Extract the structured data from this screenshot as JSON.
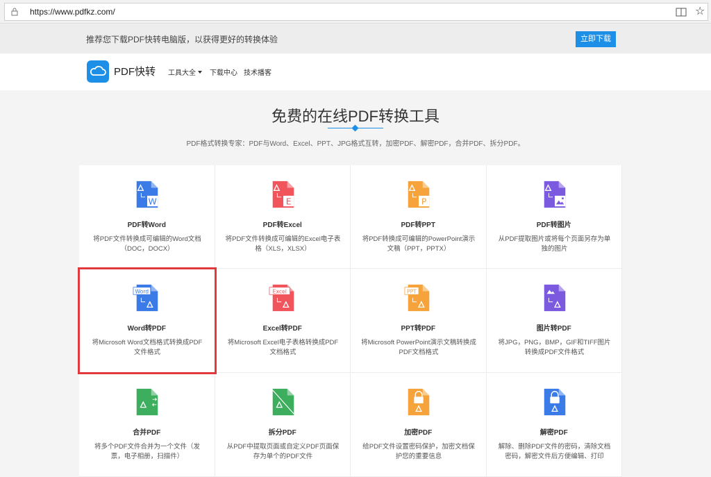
{
  "browser": {
    "url": "https://www.pdfkz.com/",
    "lock_icon": "lock-icon",
    "reader_icon": "reader-view-icon",
    "star_icon": "favorite-star-icon"
  },
  "promo": {
    "text": "推荐您下载PDF快转电脑版，以获得更好的转换体验",
    "button": "立即下载"
  },
  "nav": {
    "logo_text": "PDF快转",
    "items": [
      "工具大全",
      "下载中心",
      "技术播客"
    ]
  },
  "hero": {
    "title": "免费的在线PDF转换工具",
    "subtitle": "PDF格式转换专家：PDF与Word、Excel、PPT、JPG格式互转，加密PDF、解密PDF，合并PDF、拆分PDF。"
  },
  "colors": {
    "accent": "#1d8fe7",
    "word": "#3b7be8",
    "excel": "#f2545b",
    "ppt": "#f5a33a",
    "image": "#7b5ae0",
    "merge": "#3cae5d",
    "selection": "#e0393e"
  },
  "cards": [
    {
      "title": "PDF转Word",
      "desc": "将PDF文件转换成可编辑的Word文档（DOC，DOCX）",
      "icon": "pdf-to-word-icon",
      "letter": "W",
      "color": "#3b7be8"
    },
    {
      "title": "PDF转Excel",
      "desc": "将PDF文件转换成可编辑的Excel电子表格（XLS，XLSX）",
      "icon": "pdf-to-excel-icon",
      "letter": "E",
      "color": "#f2545b"
    },
    {
      "title": "PDF转PPT",
      "desc": "将PDF转换成可编辑的PowerPoint演示文稿（PPT，PPTX）",
      "icon": "pdf-to-ppt-icon",
      "letter": "P",
      "color": "#f5a33a"
    },
    {
      "title": "PDF转图片",
      "desc": "从PDF提取图片或将每个页面另存为单独的图片",
      "icon": "pdf-to-image-icon",
      "letter": "",
      "color": "#7b5ae0"
    },
    {
      "title": "Word转PDF",
      "desc": "将Microsoft Word文档格式转换成PDF文件格式",
      "icon": "word-to-pdf-icon",
      "tag": "Word",
      "color": "#3b7be8"
    },
    {
      "title": "Excel转PDF",
      "desc": "将Microsoft Excel电子表格转换成PDF文档格式",
      "icon": "excel-to-pdf-icon",
      "tag": "Excel",
      "color": "#f2545b"
    },
    {
      "title": "PPT转PDF",
      "desc": "将Microsoft PowerPoint演示文稿转换成PDF文档格式",
      "icon": "ppt-to-pdf-icon",
      "tag": "PPT",
      "color": "#f5a33a"
    },
    {
      "title": "图片转PDF",
      "desc": "将JPG，PNG，BMP，GIF和TIFF图片转换成PDF文件格式",
      "icon": "image-to-pdf-icon",
      "tag": "",
      "color": "#7b5ae0"
    },
    {
      "title": "合并PDF",
      "desc": "将多个PDF文件合并为一个文件（发票，电子相册，扫描件）",
      "icon": "merge-pdf-icon",
      "color": "#3cae5d"
    },
    {
      "title": "拆分PDF",
      "desc": "从PDF中提取页面或自定义PDF页面保存为单个的PDF文件",
      "icon": "split-pdf-icon",
      "color": "#3cae5d"
    },
    {
      "title": "加密PDF",
      "desc": "给PDF文件设置密码保护，加密文档保护您的重要信息",
      "icon": "encrypt-pdf-icon",
      "color": "#f5a33a"
    },
    {
      "title": "解密PDF",
      "desc": "解除、删除PDF文件的密码，清除文档密码，解密文件后方便编辑、打印",
      "icon": "decrypt-pdf-icon",
      "color": "#3b7be8"
    }
  ]
}
